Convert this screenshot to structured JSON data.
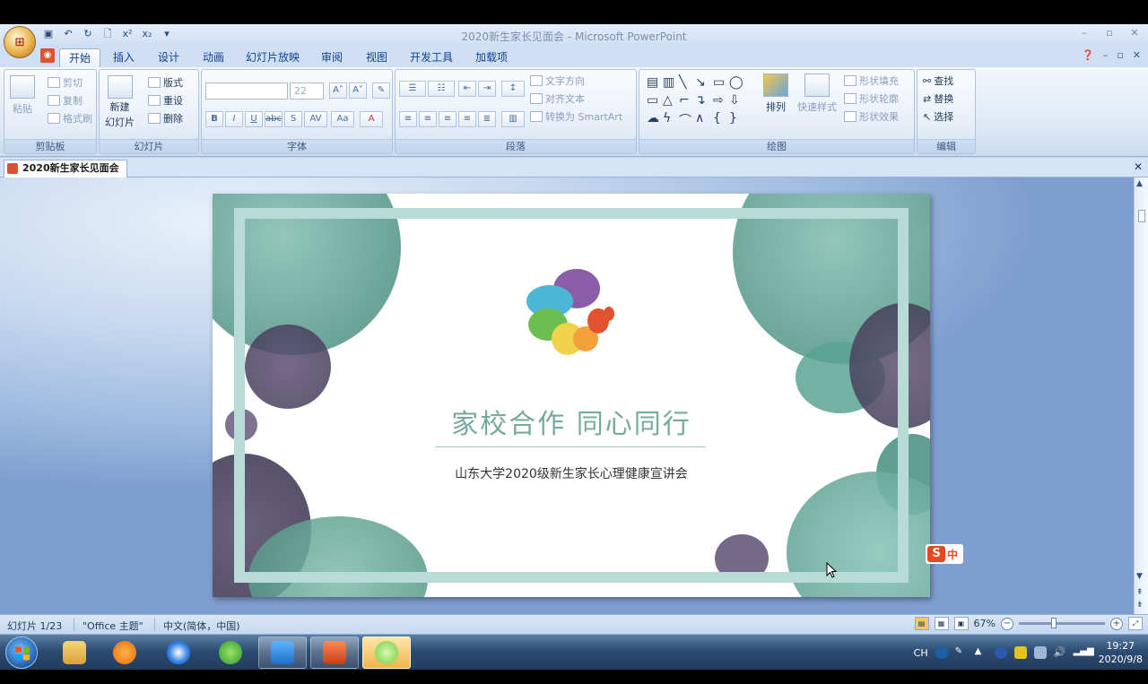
{
  "window": {
    "title": "2020新生家长见面会 - Microsoft PowerPoint"
  },
  "office_button": {
    "glyph": "⊞"
  },
  "quick_access": [
    {
      "name": "save-icon",
      "glyph": "💾"
    },
    {
      "name": "undo-icon",
      "glyph": "↶"
    },
    {
      "name": "redo-icon",
      "glyph": "↻"
    },
    {
      "name": "print-preview-icon",
      "glyph": "🗋"
    },
    {
      "name": "superscript-icon",
      "glyph": "x²"
    },
    {
      "name": "subscript-icon",
      "glyph": "x₂"
    },
    {
      "name": "customize-icon",
      "glyph": "▾"
    }
  ],
  "tabs": [
    "开始",
    "插入",
    "设计",
    "动画",
    "幻灯片放映",
    "审阅",
    "视图",
    "开发工具",
    "加载项"
  ],
  "active_tab": "开始",
  "ribbon": {
    "clipboard": {
      "label": "剪贴板",
      "paste": "粘贴",
      "cut": "剪切",
      "copy": "复制",
      "format_painter": "格式刷"
    },
    "slides": {
      "label": "幻灯片",
      "new_slide_1": "新建",
      "new_slide_2": "幻灯片",
      "layout": "版式",
      "reset": "重设",
      "delete": "删除"
    },
    "font": {
      "label": "字体",
      "font_size": "22",
      "bold": "B",
      "italic": "I",
      "underline": "U",
      "strike": "abc",
      "shadow": "S",
      "spacing": "AV",
      "case": "Aa",
      "color": "A"
    },
    "paragraph": {
      "label": "段落",
      "text_direction": "文字方向",
      "align_text": "对齐文本",
      "smartart": "转换为 SmartArt"
    },
    "drawing": {
      "label": "绘图",
      "arrange": "排列",
      "quick_styles": "快速样式",
      "shape_fill": "形状填充",
      "shape_outline": "形状轮廓",
      "shape_effects": "形状效果"
    },
    "editing": {
      "label": "编辑",
      "find": "查找",
      "replace": "替换",
      "select": "选择"
    }
  },
  "document_tab": {
    "label": "2020新生家长见面会"
  },
  "slide": {
    "title": "家校合作  同心同行",
    "subtitle": "山东大学2020级新生家长心理健康宣讲会"
  },
  "ime": {
    "logo": "S",
    "mode": "中"
  },
  "statusbar": {
    "slide_info": "幻灯片 1/23",
    "theme": "\"Office 主题\"",
    "language": "中文(简体，中国)",
    "zoom": "67%"
  },
  "taskbar": {
    "tray_lang": "CH",
    "time": "19:27",
    "date": "2020/9/8"
  },
  "colors": {
    "slide_teal": "#6aa898",
    "slide_purple": "#5b4c6e",
    "title_color": "#78a99d"
  }
}
